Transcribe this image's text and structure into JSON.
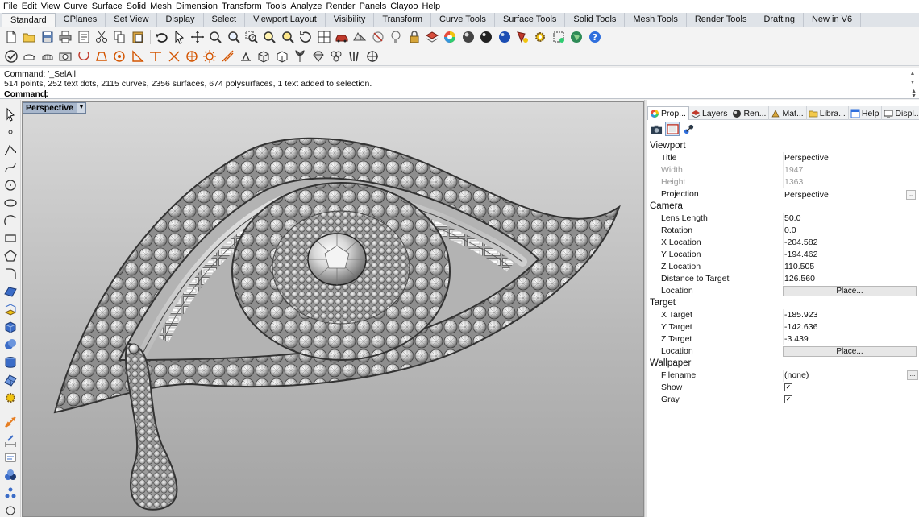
{
  "menu": [
    "File",
    "Edit",
    "View",
    "Curve",
    "Surface",
    "Solid",
    "Mesh",
    "Dimension",
    "Transform",
    "Tools",
    "Analyze",
    "Render",
    "Panels",
    "Clayoo",
    "Help"
  ],
  "tabs": [
    "Standard",
    "CPlanes",
    "Set View",
    "Display",
    "Select",
    "Viewport Layout",
    "Visibility",
    "Transform",
    "Curve Tools",
    "Surface Tools",
    "Solid Tools",
    "Mesh Tools",
    "Render Tools",
    "Drafting",
    "New in V6"
  ],
  "active_tab": "Standard",
  "command": {
    "history_1": "Command: '_SelAll",
    "history_2": "514 points, 252 text dots, 2115 curves, 2356 surfaces, 674 polysurfaces, 1 text added to selection.",
    "prompt_label": "Command:",
    "input_value": ""
  },
  "viewport": {
    "title": "Perspective"
  },
  "panel": {
    "tabs": [
      {
        "label": "Prop...",
        "icon": "properties-icon",
        "active": true
      },
      {
        "label": "Layers",
        "icon": "layers-icon",
        "active": false
      },
      {
        "label": "Ren...",
        "icon": "rendering-icon",
        "active": false
      },
      {
        "label": "Mat...",
        "icon": "materials-icon",
        "active": false
      },
      {
        "label": "Libra...",
        "icon": "libraries-icon",
        "active": false
      },
      {
        "label": "Help",
        "icon": "help-icon",
        "active": false
      },
      {
        "label": "Displ...",
        "icon": "display-icon",
        "active": false
      }
    ],
    "more": "⯈",
    "sections": {
      "viewport": {
        "heading": "Viewport",
        "title_label": "Title",
        "title_value": "Perspective",
        "width_label": "Width",
        "width_value": "1947",
        "height_label": "Height",
        "height_value": "1363",
        "projection_label": "Projection",
        "projection_value": "Perspective"
      },
      "camera": {
        "heading": "Camera",
        "lens_label": "Lens Length",
        "lens_value": "50.0",
        "rotation_label": "Rotation",
        "rotation_value": "0.0",
        "xloc_label": "X Location",
        "xloc_value": "-204.582",
        "yloc_label": "Y Location",
        "yloc_value": "-194.462",
        "zloc_label": "Z Location",
        "zloc_value": "110.505",
        "dist_label": "Distance to Target",
        "dist_value": "126.560",
        "location_label": "Location",
        "place_button": "Place..."
      },
      "target": {
        "heading": "Target",
        "xt_label": "X Target",
        "xt_value": "-185.923",
        "yt_label": "Y Target",
        "yt_value": "-142.636",
        "zt_label": "Z Target",
        "zt_value": "-3.439",
        "location_label": "Location",
        "place_button": "Place..."
      },
      "wallpaper": {
        "heading": "Wallpaper",
        "filename_label": "Filename",
        "filename_value": "(none)",
        "browse": "...",
        "show_label": "Show",
        "show_checked": true,
        "gray_label": "Gray",
        "gray_checked": true
      }
    }
  },
  "check_glyph": "✓",
  "dropdown_glyph": "⌄"
}
